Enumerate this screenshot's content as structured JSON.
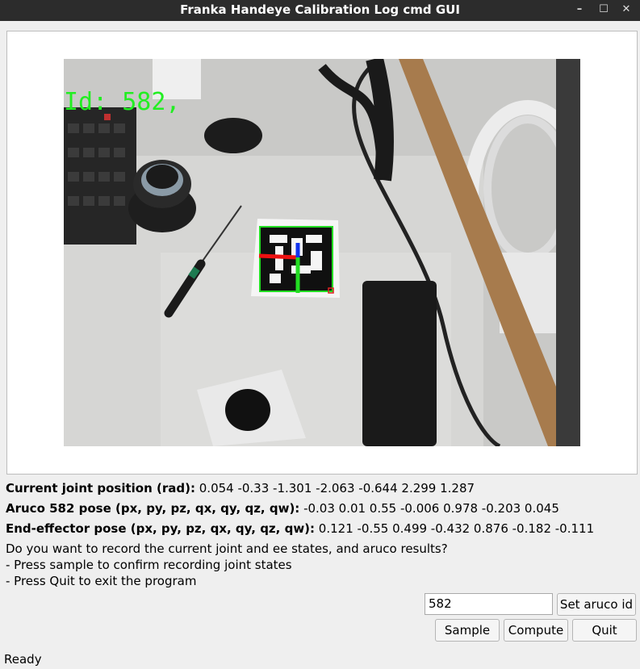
{
  "window": {
    "title": "Franka Handeye Calibration Log cmd GUI",
    "minimize_glyph": "–",
    "maximize_glyph": "☐",
    "close_glyph": "✕"
  },
  "camera": {
    "overlay_text": "Id: 582,"
  },
  "info": {
    "joint_label": "Current joint position (rad):",
    "joint_value": " 0.054 -0.33 -1.301 -2.063 -0.644 2.299 1.287",
    "aruco_label": "Aruco 582 pose (px, py, pz, qx, qy, qz, qw):",
    "aruco_value": " -0.03 0.01 0.55 -0.006 0.978 -0.203 0.045",
    "ee_label": "End-effector pose (px, py, pz, qx, qy, qz, qw):",
    "ee_value": " 0.121 -0.55 0.499 -0.432 0.876 -0.182 -0.111"
  },
  "prompt": {
    "line1": "Do you want to record the current joint and ee states, and aruco results?",
    "line2": "- Press sample to confirm recording joint states",
    "line3": "- Press Quit to exit the program"
  },
  "controls": {
    "aruco_id_value": "582",
    "set_aruco_label": "Set aruco id",
    "sample_label": "Sample",
    "compute_label": "Compute",
    "quit_label": "Quit"
  },
  "status": {
    "text": "Ready"
  }
}
